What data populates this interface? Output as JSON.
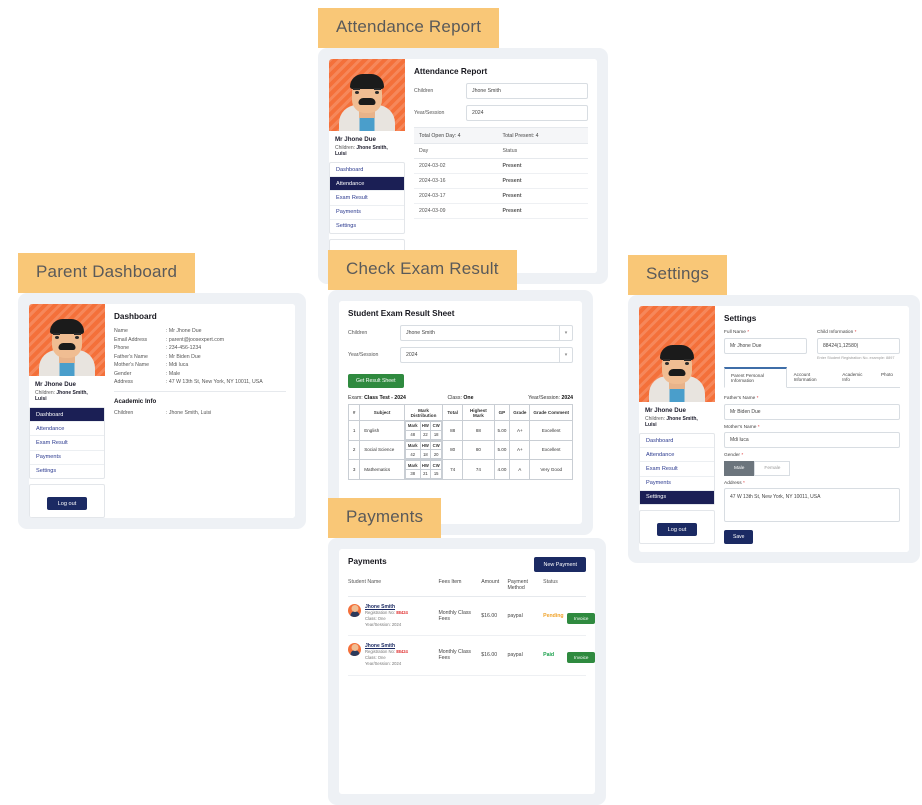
{
  "panels": {
    "attendance": {
      "tag": "Attendance Report",
      "title": "Attendance Report",
      "fields": [
        {
          "label": "Children",
          "value": "Jhone Smith"
        },
        {
          "label": "Year/Session",
          "value": "2024"
        }
      ],
      "totals": {
        "open_day": "Total Open Day: 4",
        "present": "Total Present: 4"
      },
      "columns": [
        "Day",
        "Status"
      ],
      "rows": [
        {
          "day": "2024-03-02",
          "status": "Present"
        },
        {
          "day": "2024-03-16",
          "status": "Present"
        },
        {
          "day": "2024-03-17",
          "status": "Present"
        },
        {
          "day": "2024-03-09",
          "status": "Present"
        }
      ]
    },
    "dashboard": {
      "tag": "Parent Dashboard",
      "title": "Dashboard",
      "info": [
        {
          "label": "Name",
          "value": ": Mr Jhone Due"
        },
        {
          "label": "Email Address",
          "value": ": parent@joosexpert.com"
        },
        {
          "label": "Phone",
          "value": ": 234-456-1234"
        },
        {
          "label": "Father's Name",
          "value": ": Mr Biden Due"
        },
        {
          "label": "Mother's Name",
          "value": ": Mdi luca"
        },
        {
          "label": "Gender",
          "value": ": Male"
        },
        {
          "label": "Address",
          "value": ": 47 W 13th St, New York, NY 10011, USA"
        }
      ],
      "academic_title": "Academic Info",
      "academic": [
        {
          "label": "Children",
          "value": ": Jhone Smith, Luisi"
        }
      ]
    },
    "exam": {
      "tag": "Check Exam Result",
      "title": "Student Exam Result Sheet",
      "fields": [
        {
          "label": "Children",
          "value": "Jhone Smith"
        },
        {
          "label": "Year/Session",
          "value": "2024"
        }
      ],
      "button": "Get Result Sheet",
      "meta": {
        "exam_label": "Exam:",
        "exam_value": "Class Test - 2024",
        "class_label": "Class:",
        "class_value": "One",
        "year_label": "Year/Session:",
        "year_value": "2024"
      },
      "columns": [
        "#",
        "Subject",
        "Mark Distribution",
        "Total",
        "Highest Mark",
        "GP",
        "Grade",
        "Grade Comment"
      ],
      "dist_headers": [
        "Mark",
        "HW",
        "CW"
      ],
      "rows": [
        {
          "no": "1",
          "subject": "English",
          "mark": "48",
          "hw": "22",
          "cw": "18",
          "total": "88",
          "highest": "88",
          "gp": "5.00",
          "grade": "A+",
          "comment": "Excellent"
        },
        {
          "no": "2",
          "subject": "Social Science",
          "mark": "42",
          "hw": "18",
          "cw": "20",
          "total": "80",
          "highest": "80",
          "gp": "5.00",
          "grade": "A+",
          "comment": "Excellent"
        },
        {
          "no": "3",
          "subject": "Mathematics",
          "mark": "38",
          "hw": "21",
          "cw": "15",
          "total": "74",
          "highest": "74",
          "gp": "4.00",
          "grade": "A",
          "comment": "Very Good"
        }
      ]
    },
    "payments": {
      "tag": "Payments",
      "title": "Payments",
      "new_button": "New Payment",
      "columns": [
        "Student Name",
        "Fees Item",
        "Amount",
        "Payment Method",
        "Status"
      ],
      "rows": [
        {
          "name": "Jhone Smith",
          "reg_label": "Registration No:",
          "reg_no": "88424",
          "class": "Class: One",
          "year": "Year/Session: 2024",
          "fees": "Monthly Class Fees",
          "amount": "$16.00",
          "method": "paypal",
          "status": "Pending",
          "action": "Invoice"
        },
        {
          "name": "Jhone Smith",
          "reg_label": "Registration No:",
          "reg_no": "88424",
          "class": "Class: One",
          "year": "Year/Session: 2024",
          "fees": "Monthly Class Fees",
          "amount": "$16.00",
          "method": "paypal",
          "status": "Paid",
          "action": "Invoice"
        }
      ]
    },
    "settings": {
      "tag": "Settings",
      "title": "Settings",
      "full_name_label": "Full Name",
      "full_name_value": "Mr Jhone Due",
      "child_label": "Child Information",
      "child_value": "88424(1,12580)",
      "child_hint": "Enter Student Registration No. example: 8897",
      "tabs": [
        "Parent Personal Information",
        "Account Information",
        "Academic Info",
        "Photo"
      ],
      "father_label": "Father's Name",
      "father_value": "Mr Biden Due",
      "mother_label": "Mother's Name",
      "mother_value": "Mdi luca",
      "gender_label": "Gender",
      "gender_male": "Male",
      "gender_female": "Female",
      "address_label": "Address",
      "address_value": "47 W 13th St, New York, NY 10011, USA",
      "save": "Save"
    }
  },
  "sidebar": {
    "name": "Mr Jhone Due",
    "children_label": "Children:",
    "children_value": "Jhone Smith, Luisi",
    "items": [
      "Dashboard",
      "Attendance",
      "Exam Result",
      "Payments",
      "Settings"
    ],
    "logout": "Log out"
  },
  "colors": {
    "tag_bg": "#f9c777",
    "navy": "#1b2a63",
    "green": "#2f8a3f",
    "orange": "#f0a32a",
    "avatar_bg": "#f4703a"
  }
}
